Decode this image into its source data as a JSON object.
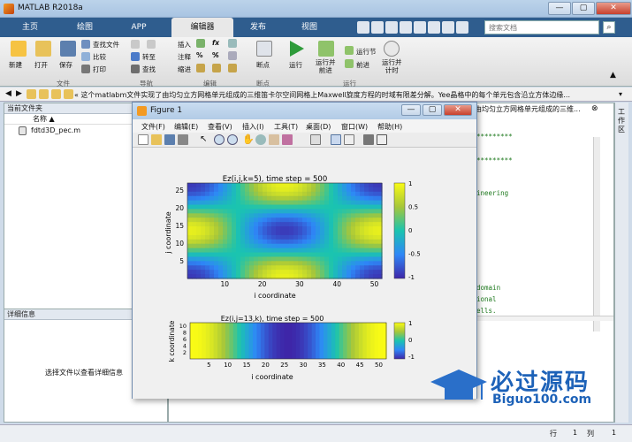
{
  "window": {
    "title": "MATLAB R2018a",
    "min": "—",
    "max": "▢",
    "close": "✕"
  },
  "tabs": [
    {
      "label": "主页"
    },
    {
      "label": "绘图"
    },
    {
      "label": "APP"
    },
    {
      "label": "编辑器"
    },
    {
      "label": "发布"
    },
    {
      "label": "视图"
    }
  ],
  "search": {
    "placeholder": "搜索文档"
  },
  "ribbon": {
    "file": {
      "new": "新建",
      "open": "打开",
      "save": "保存",
      "find_files": "查找文件",
      "compare": "比较",
      "print": "打印",
      "group": "文件"
    },
    "nav": {
      "goto": "转至",
      "find": "查找",
      "group": "导航"
    },
    "edit": {
      "insert": "插入",
      "comment": "注释",
      "indent": "缩进",
      "fx": "fx",
      "group": "编辑"
    },
    "breakpoints": {
      "label": "断点",
      "group": "断点"
    },
    "run": {
      "run": "运行",
      "run_advance": "运行并\n前进",
      "run_section": "运行节",
      "advance": "前进",
      "run_time": "运行并\n计时",
      "group": "运行"
    }
  },
  "address": {
    "path": "« 这个matlabm文件实现了由均匀立方网格单元组成的三维笛卡尔空间网格上Maxwell旋度方程的时域有限差分解。Yee晶格中的每个单元包含沿立方体边缘..."
  },
  "leftpane": {
    "header": "当前文件夹",
    "col_name": "名称 ▲",
    "file": "fdtd3D_pec.m"
  },
  "detail": {
    "header": "详细信息",
    "hint": "选择文件以查看详细信息"
  },
  "editor": {
    "banner": "由均匀立方网格单元组成的三维...",
    "lines": [
      "*********",
      "*********",
      "ineering",
      "domain",
      "ional",
      "ells."
    ],
    "side_label": "工作区"
  },
  "status": {
    "row_label": "行",
    "row": "1",
    "col_label": "列",
    "col": "1"
  },
  "figure": {
    "title": "Figure 1",
    "menu": [
      "文件(F)",
      "编辑(E)",
      "查看(V)",
      "插入(I)",
      "工具(T)",
      "桌面(D)",
      "窗口(W)",
      "帮助(H)"
    ],
    "plot1": {
      "title": "Ez(i,j,k=5), time step = 500",
      "xlabel": "i coordinate",
      "ylabel": "j coordinate",
      "xticks": [
        "10",
        "20",
        "30",
        "40",
        "50"
      ],
      "yticks": [
        "25",
        "20",
        "15",
        "10",
        "5"
      ],
      "cticks": [
        "1",
        "0.5",
        "0",
        "-0.5",
        "-1"
      ]
    },
    "plot2": {
      "title": "Ez(i,j=13,k), time step = 500",
      "xlabel": "i coordinate",
      "ylabel": "k coordinate",
      "xticks": [
        "5",
        "10",
        "15",
        "20",
        "25",
        "30",
        "35",
        "40",
        "45",
        "50"
      ],
      "yticks": [
        "10",
        "8",
        "6",
        "4",
        "2"
      ],
      "cticks": [
        "1",
        "0",
        "-1"
      ]
    }
  },
  "watermark": {
    "brand": "必过源码",
    "url": "Biguo100.com"
  },
  "colors": {
    "tab_bar": "#2f5d8e",
    "colormap": [
      "#3e26a8",
      "#2e87f7",
      "#1ac4b0",
      "#a6c63a",
      "#f9fb15"
    ]
  }
}
